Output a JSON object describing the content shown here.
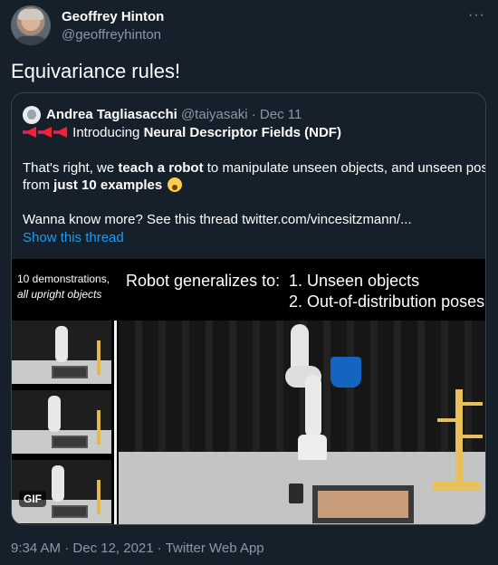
{
  "tweet": {
    "author_name": "Geoffrey Hinton",
    "author_handle": "@geoffreyhinton",
    "more_label": "···",
    "text": "Equivariance rules!"
  },
  "quote": {
    "author_name": "Andrea Tagliasacchi",
    "author_handle": "@taiyasaki",
    "separator": " · ",
    "date": "Dec 11",
    "line1_text": "Introducing",
    "line1_bold": "Neural Descriptor Fields (NDF)",
    "line2_a": "That's right, we ",
    "line2_bold": "teach a robot",
    "line2_b": " to manipulate unseen objects, and unseen poses",
    "line3_a": "from ",
    "line3_bold": "just 10 examples",
    "line4": "Wanna know more? See this thread twitter.com/vincesitzmann/...",
    "show_thread": "Show this thread",
    "megaphone_icon": "megaphone-icon",
    "emoji_icon": "shocked-face-icon"
  },
  "media": {
    "caption_left_1": "10 demonstrations,",
    "caption_left_2": "all upright objects",
    "caption_main": "Robot generalizes to:",
    "caption_item_1": "1. Unseen objects",
    "caption_item_2": "2. Out-of-distribution poses",
    "gif_label": "GIF"
  },
  "meta": {
    "time": "9:34 AM",
    "dot1": " · ",
    "date": "Dec 12, 2021",
    "dot2": " · ",
    "source": "Twitter Web App"
  },
  "colors": {
    "background": "#15202b",
    "link": "#1d9bf0",
    "muted": "#8b98a5",
    "border": "#38444d"
  }
}
